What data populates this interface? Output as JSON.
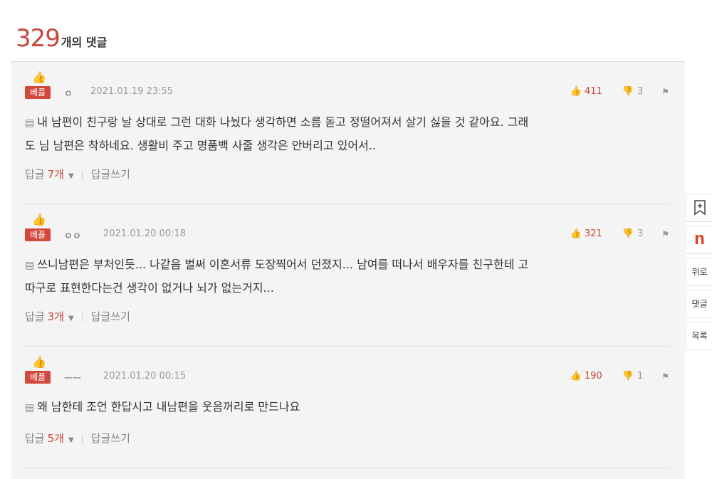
{
  "header": {
    "count": "329",
    "label": "개의 댓글"
  },
  "colors": {
    "accent": "#c8473b",
    "best_tag": "#d2483c",
    "naver_n": "#e2401c"
  },
  "comments": [
    {
      "best_label": "베플",
      "author": "ㅇ",
      "date": "2021.01.19 23:55",
      "likes": "411",
      "dislikes": "3",
      "line1": "내 남편이 친구랑 날 상대로 그런 대화 나눴다 생각하면 소름 돋고 정떨어져서 살기 싫을 것 같아요. 그래",
      "line2": "도 님 남편은 착하네요. 생활비 주고 명품백 사줄 생각은 안버리고 있어서..",
      "reply_label": "답글",
      "reply_count": "7개",
      "write_label": "답글쓰기"
    },
    {
      "best_label": "베플",
      "author": "ㅇㅇ",
      "date": "2021.01.20 00:18",
      "likes": "321",
      "dislikes": "3",
      "line1": "쓰니남편은 부처인듯... 나같음 벌써 이혼서류 도장찍어서 던졌지... 남여를 떠나서 배우자를 친구한테 고",
      "line2": "따구로 표현한다는건 생각이 없거나 뇌가 없는거지...",
      "reply_label": "답글",
      "reply_count": "3개",
      "write_label": "답글쓰기"
    },
    {
      "best_label": "베플",
      "author": "ㅡㅡ",
      "date": "2021.01.20 00:15",
      "likes": "190",
      "dislikes": "1",
      "line1": "왜 남한테 조언 한답시고 내남편을 웃음꺼리로 만드나요",
      "line2": "",
      "reply_label": "답글",
      "reply_count": "5개",
      "write_label": "답글쓰기"
    }
  ],
  "sidebar": {
    "bookmark_icon": "bookmark-plus-icon",
    "naver_label": "n",
    "top_label": "위로",
    "comments_label": "댓글",
    "list_label": "목록"
  }
}
